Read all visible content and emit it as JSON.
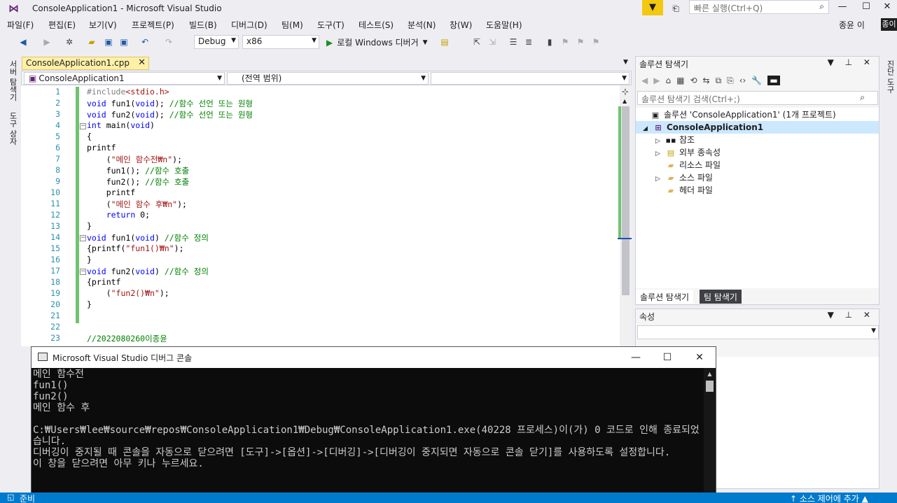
{
  "window": {
    "title": "ConsoleApplication1 - Microsoft Visual Studio",
    "quick_launch_placeholder": "빠른 실행(Ctrl+Q)",
    "minimize": "—",
    "maximize": "☐",
    "close": "✕"
  },
  "menu": {
    "items": [
      "파일(F)",
      "편집(E)",
      "보기(V)",
      "프로젝트(P)",
      "빌드(B)",
      "디버그(D)",
      "팀(M)",
      "도구(T)",
      "테스트(S)",
      "분석(N)",
      "창(W)",
      "도움말(H)"
    ],
    "user": "종윤 이",
    "user_badge": "종이"
  },
  "toolbar": {
    "config": "Debug",
    "platform": "x86",
    "run_label": "로컬 Windows 디버거"
  },
  "side_tabs": {
    "left": [
      "서버 탐색기",
      "도구 상자"
    ],
    "right": "진단 도구"
  },
  "editor": {
    "tab_title": "ConsoleApplication1.cpp",
    "scope_project": "ConsoleApplication1",
    "scope_global": "(전역 범위)",
    "line_numbers": [
      "1",
      "2",
      "3",
      "4",
      "5",
      "6",
      "7",
      "8",
      "9",
      "10",
      "11",
      "12",
      "13",
      "14",
      "15",
      "16",
      "17",
      "18",
      "19",
      "20",
      "21",
      "22",
      "23"
    ],
    "lines": {
      "l1a": "#include",
      "l1b": "<stdio.h>",
      "l2a": "void",
      "l2b": " fun1(",
      "l2c": "void",
      "l2d": "); ",
      "l2e": "//함수 선언 또는 원형",
      "l3a": "void",
      "l3b": " fun2(",
      "l3c": "void",
      "l3d": "); ",
      "l3e": "//함수 선언 또는 원형",
      "l4a": "int",
      "l4b": " main(",
      "l4c": "void",
      "l4d": ")",
      "l5": "{",
      "l6": "printf",
      "l7a": "    (",
      "l7b": "\"메인 함수전₩n\"",
      "l7c": ");",
      "l8a": "    fun1(); ",
      "l8b": "//함수 호출",
      "l9a": "    fun2(); ",
      "l9b": "//함수 호출",
      "l10": "    printf",
      "l11a": "    (",
      "l11b": "\"메인 함수 후₩n\"",
      "l11c": ");",
      "l12a": "    ",
      "l12b": "return",
      "l12c": " 0;",
      "l13": "}",
      "l14a": "void",
      "l14b": " fun1(",
      "l14c": "void",
      "l14d": ") ",
      "l14e": "//함수 정의",
      "l15a": "{printf(",
      "l15b": "\"fun1()₩n\"",
      "l15c": ");",
      "l16": "}",
      "l17a": "void",
      "l17b": " fun2(",
      "l17c": "void",
      "l17d": ") ",
      "l17e": "//함수 정의",
      "l18": "{printf",
      "l19a": "    (",
      "l19b": "\"fun2()₩n\"",
      "l19c": ");",
      "l20": "}",
      "l23": "//2022080260이종윤"
    }
  },
  "solution_explorer": {
    "title": "솔루션 탐색기",
    "search_placeholder": "솔루션 탐색기 검색(Ctrl+;)",
    "tree": {
      "solution": "솔루션 'ConsoleApplication1' (1개 프로젝트)",
      "project": "ConsoleApplication1",
      "references": "참조",
      "external": "외부 종속성",
      "resources": "리소스 파일",
      "sources": "소스 파일",
      "headers": "헤더 파일"
    },
    "tabs": [
      "솔루션 탐색기",
      "팀 탐색기"
    ]
  },
  "properties": {
    "title": "속성"
  },
  "console": {
    "title": "Microsoft Visual Studio 디버그 콘솔",
    "output": "메인 함수전\nfun1()\nfun2()\n메인 함수 후\n\nC:₩Users₩lee₩source₩repos₩ConsoleApplication1₩Debug₩ConsoleApplication1.exe(40228 프로세스)이(가) 0 코드로 인해 종료되었습니다.\n디버깅이 중지될 때 콘솔을 자동으로 닫으려면 [도구]->[옵션]->[디버깅]->[디버깅이 중지되면 자동으로 콘솔 닫기]를 사용하도록 설정합니다.\n이 창을 닫으려면 아무 키나 누르세요."
  },
  "status": {
    "left": "준비",
    "right": "↑ 소스 제어에 추가 ▲"
  },
  "colors": {
    "accent": "#007acc",
    "keyword": "#0000ff",
    "comment": "#008000",
    "string": "#a31515",
    "line_number": "#2b91af",
    "tab_active": "#fff0a8"
  }
}
